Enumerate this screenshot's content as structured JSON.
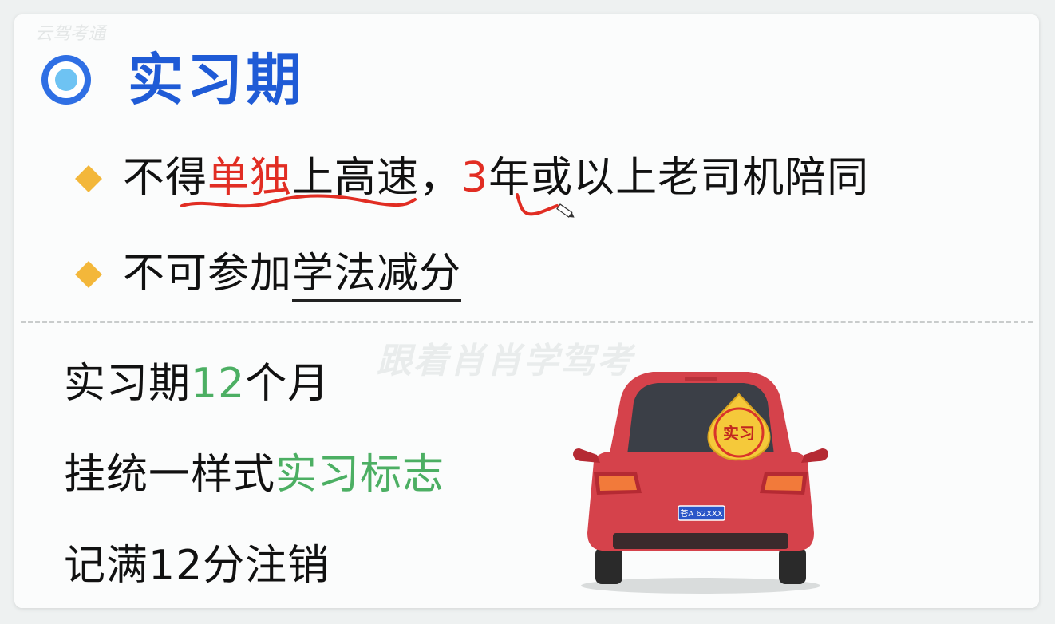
{
  "watermark_top": "云驾考通",
  "title": {
    "text": "实习期"
  },
  "bullets": [
    {
      "pre": "不得",
      "highlight": "单独",
      "mid": "上高速，",
      "highlight2": "3",
      "post": "年或以上老司机陪同"
    },
    {
      "pre": "不可参加",
      "underlined": "学法减分"
    }
  ],
  "watermark": "跟着肖肖学驾考",
  "info": [
    {
      "pre": "实习期",
      "highlight": "12",
      "post": "个月"
    },
    {
      "pre": "挂统一样式",
      "highlight": "实习标志",
      "post": ""
    },
    {
      "pre": "记满12分注销",
      "highlight": "",
      "post": ""
    }
  ],
  "car": {
    "sign_text": "实习",
    "plate": "苍A 62XXX",
    "body_color": "#d5424b",
    "sign_color": "#f5c93a"
  },
  "colors": {
    "title": "#1f5bd6",
    "red": "#e12d23",
    "green": "#4caf63",
    "diamond": "#f3b73a"
  }
}
